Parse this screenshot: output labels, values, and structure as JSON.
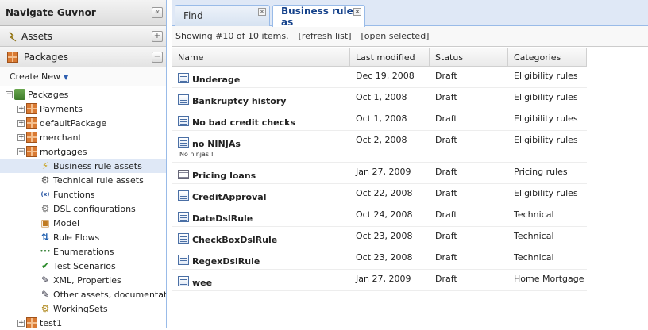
{
  "nav": {
    "title": "Navigate Guvnor",
    "collapse_symbol": "«",
    "assets_label": "Assets",
    "assets_toggle": "+",
    "packages_label": "Packages",
    "packages_toggle": "−",
    "create_new": "Create New",
    "tree": [
      {
        "label": "Packages",
        "level": 0,
        "expander": "−",
        "icon": "packages-root-icon"
      },
      {
        "label": "Payments",
        "level": 1,
        "expander": "+",
        "icon": "package-icon"
      },
      {
        "label": "defaultPackage",
        "level": 1,
        "expander": "+",
        "icon": "package-icon"
      },
      {
        "label": "merchant",
        "level": 1,
        "expander": "+",
        "icon": "package-icon"
      },
      {
        "label": "mortgages",
        "level": 1,
        "expander": "−",
        "icon": "package-icon"
      },
      {
        "label": "Business rule assets",
        "level": 2,
        "icon": "business-rule-icon",
        "selected": true
      },
      {
        "label": "Technical rule assets",
        "level": 2,
        "icon": "technical-rule-icon"
      },
      {
        "label": "Functions",
        "level": 2,
        "icon": "function-icon"
      },
      {
        "label": "DSL configurations",
        "level": 2,
        "icon": "dsl-icon"
      },
      {
        "label": "Model",
        "level": 2,
        "icon": "model-icon"
      },
      {
        "label": "Rule Flows",
        "level": 2,
        "icon": "ruleflow-icon"
      },
      {
        "label": "Enumerations",
        "level": 2,
        "icon": "enumeration-icon"
      },
      {
        "label": "Test Scenarios",
        "level": 2,
        "icon": "test-scenario-icon"
      },
      {
        "label": "XML, Properties",
        "level": 2,
        "icon": "xml-icon"
      },
      {
        "label": "Other assets, documentation",
        "level": 2,
        "icon": "other-assets-icon"
      },
      {
        "label": "WorkingSets",
        "level": 2,
        "icon": "workingsets-icon"
      },
      {
        "label": "test1",
        "level": 1,
        "expander": "+",
        "icon": "package-icon"
      }
    ]
  },
  "tabs": [
    {
      "label": "Find",
      "close": "×"
    },
    {
      "label": "Business rule as",
      "close": "×"
    }
  ],
  "listbar": {
    "showing": "Showing #10 of 10 items.",
    "refresh": "[refresh list]",
    "open_selected": "[open selected]"
  },
  "grid": {
    "columns": [
      "Name",
      "Last modified",
      "Status",
      "Categories"
    ],
    "rows": [
      {
        "name": "Underage",
        "modified": "Dec 19, 2008",
        "status": "Draft",
        "category": "Eligibility rules",
        "icon": "document-icon"
      },
      {
        "name": "Bankruptcy history",
        "modified": "Oct 1, 2008",
        "status": "Draft",
        "category": "Eligibility rules",
        "icon": "document-icon"
      },
      {
        "name": "No bad credit checks",
        "modified": "Oct 1, 2008",
        "status": "Draft",
        "category": "Eligibility rules",
        "icon": "document-icon"
      },
      {
        "name": "no NINJAs",
        "desc": "No ninjas !",
        "modified": "Oct 2, 2008",
        "status": "Draft",
        "category": "Eligibility rules",
        "icon": "document-icon"
      },
      {
        "name": "Pricing loans",
        "modified": "Jan 27, 2009",
        "status": "Draft",
        "category": "Pricing rules",
        "icon": "decision-table-icon"
      },
      {
        "name": "CreditApproval",
        "modified": "Oct 22, 2008",
        "status": "Draft",
        "category": "Eligibility rules",
        "icon": "document-icon"
      },
      {
        "name": "DateDslRule",
        "modified": "Oct 24, 2008",
        "status": "Draft",
        "category": "Technical",
        "icon": "document-icon"
      },
      {
        "name": "CheckBoxDslRule",
        "modified": "Oct 23, 2008",
        "status": "Draft",
        "category": "Technical",
        "icon": "document-icon"
      },
      {
        "name": "RegexDslRule",
        "modified": "Oct 23, 2008",
        "status": "Draft",
        "category": "Technical",
        "icon": "document-icon"
      },
      {
        "name": "wee",
        "modified": "Jan 27, 2009",
        "status": "Draft",
        "category": "Home Mortgage",
        "icon": "document-icon"
      }
    ]
  },
  "colors": {
    "accent": "#15428b",
    "selection": "#dfe8f6",
    "border": "#99bbe8"
  }
}
